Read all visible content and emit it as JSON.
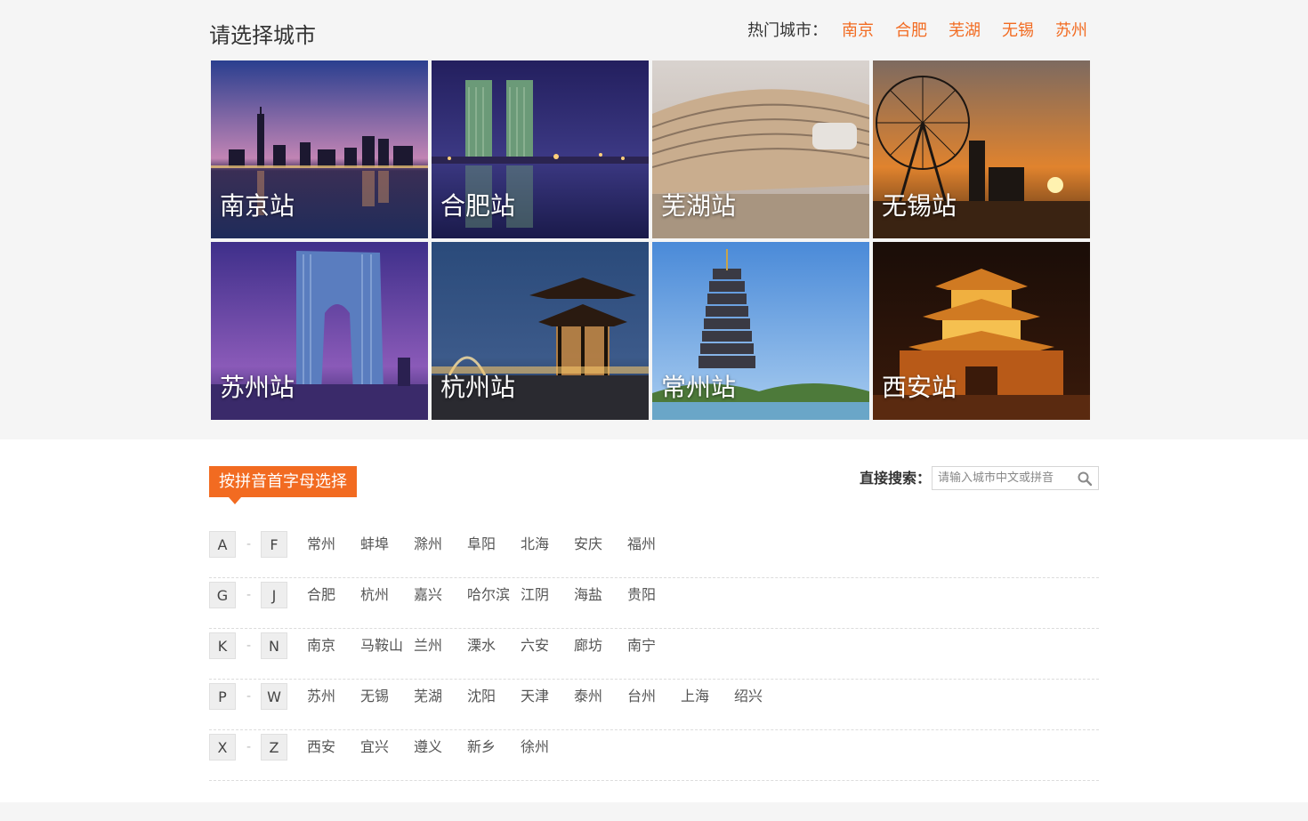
{
  "header": {
    "title": "请选择城市"
  },
  "hot_cities": {
    "label": "热门城市：",
    "items": [
      "南京",
      "合肥",
      "芜湖",
      "无锡",
      "苏州"
    ]
  },
  "stations": [
    {
      "label": "南京站",
      "scene": "city-skyline-night"
    },
    {
      "label": "合肥站",
      "scene": "twin-towers-night"
    },
    {
      "label": "芜湖站",
      "scene": "modern-station"
    },
    {
      "label": "无锡站",
      "scene": "ferris-wheel-sunset"
    },
    {
      "label": "苏州站",
      "scene": "gate-building-night"
    },
    {
      "label": "杭州站",
      "scene": "pavilion-night"
    },
    {
      "label": "常州站",
      "scene": "pagoda-day"
    },
    {
      "label": "西安站",
      "scene": "bell-tower-night"
    }
  ],
  "pinyin_tab": {
    "label": "按拼音首字母选择"
  },
  "search": {
    "label": "直接搜索：",
    "placeholder": "请输入城市中文或拼音"
  },
  "groups": [
    {
      "from": "A",
      "sep": "-",
      "to": "F",
      "cities": [
        "常州",
        "蚌埠",
        "滁州",
        "阜阳",
        "北海",
        "安庆",
        "福州"
      ]
    },
    {
      "from": "G",
      "sep": "-",
      "to": "J",
      "cities": [
        "合肥",
        "杭州",
        "嘉兴",
        "哈尔滨",
        "江阴",
        "海盐",
        "贵阳"
      ]
    },
    {
      "from": "K",
      "sep": "-",
      "to": "N",
      "cities": [
        "南京",
        "马鞍山",
        "兰州",
        "溧水",
        "六安",
        "廊坊",
        "南宁"
      ]
    },
    {
      "from": "P",
      "sep": "-",
      "to": "W",
      "cities": [
        "苏州",
        "无锡",
        "芜湖",
        "沈阳",
        "天津",
        "泰州",
        "台州",
        "上海",
        "绍兴"
      ]
    },
    {
      "from": "X",
      "sep": "-",
      "to": "Z",
      "cities": [
        "西安",
        "宜兴",
        "遵义",
        "新乡",
        "徐州"
      ]
    }
  ],
  "colors": {
    "accent": "#f26b21",
    "band": "#f5f5f5"
  }
}
